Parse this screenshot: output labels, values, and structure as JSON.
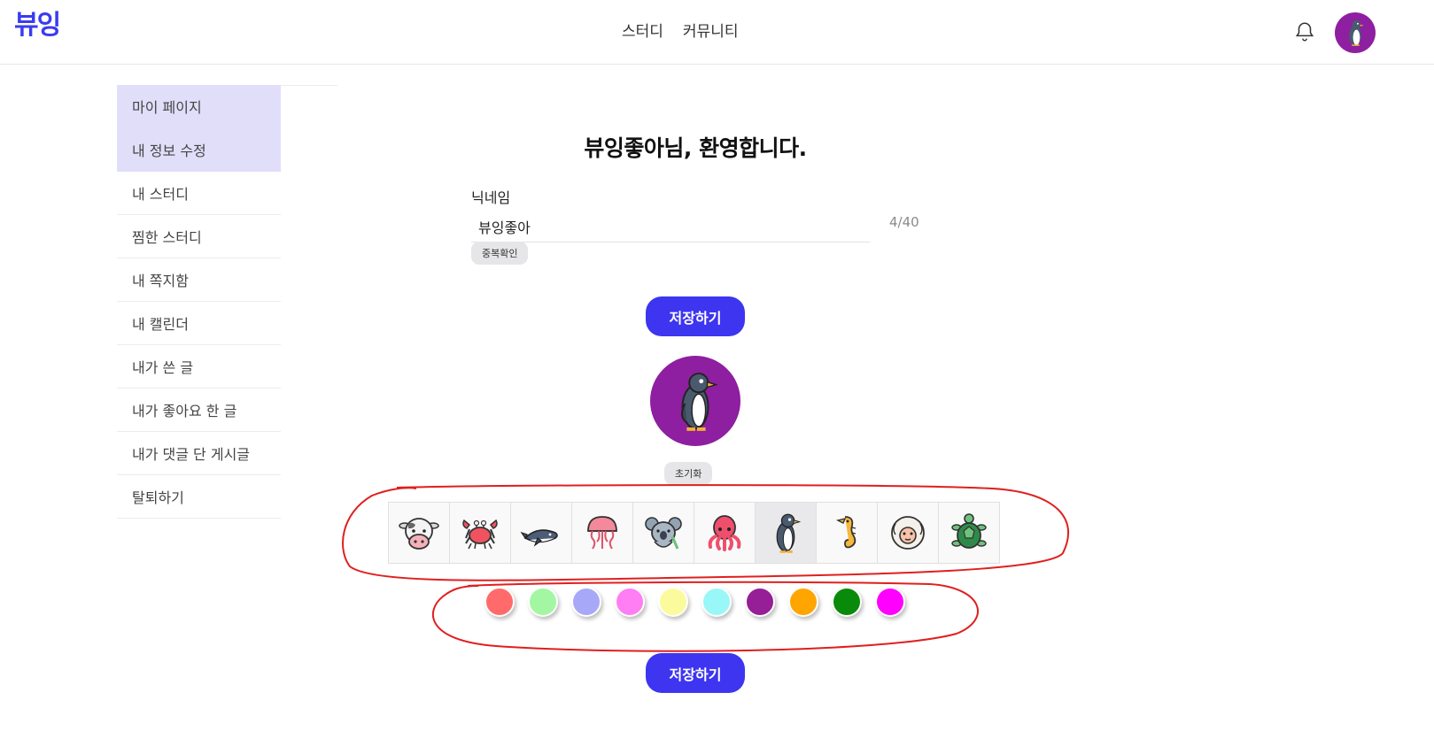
{
  "header": {
    "logo": "뷰잉",
    "nav": [
      "스터디",
      "커뮤니티"
    ]
  },
  "sidebar": {
    "items": [
      {
        "label": "마이 페이지",
        "active": true
      },
      {
        "label": "내 정보 수정",
        "active": true
      },
      {
        "label": "내 스터디",
        "active": false
      },
      {
        "label": "찜한 스터디",
        "active": false
      },
      {
        "label": "내 쪽지함",
        "active": false
      },
      {
        "label": "내 캘린더",
        "active": false
      },
      {
        "label": "내가 쓴 글",
        "active": false
      },
      {
        "label": "내가 좋아요 한 글",
        "active": false
      },
      {
        "label": "내가 댓글 단 게시글",
        "active": false
      },
      {
        "label": "탈퇴하기",
        "active": false
      }
    ]
  },
  "main": {
    "welcome": "뷰잉좋아님, 환영합니다.",
    "nickname_label": "닉네임",
    "nickname_value": "뷰잉좋아",
    "nickname_count": "4/40",
    "duplicate_check_label": "중복확인",
    "save_label": "저장하기",
    "reset_label": "초기화",
    "selected_avatar": "penguin",
    "avatar_bg": "#8e1fa0"
  },
  "animals": [
    "cow",
    "crab",
    "whale",
    "jellyfish",
    "koala",
    "octopus",
    "penguin",
    "seahorse",
    "sheep",
    "turtle"
  ],
  "colors": [
    "#ff6b6b",
    "#a3f7a3",
    "#a8a8f8",
    "#ff7ef3",
    "#fbfb9e",
    "#9af7f7",
    "#961e96",
    "#ffa500",
    "#0a8a0a",
    "#ff00ff"
  ],
  "accent": "#3d35f0",
  "annotation_color": "#e01f1f"
}
